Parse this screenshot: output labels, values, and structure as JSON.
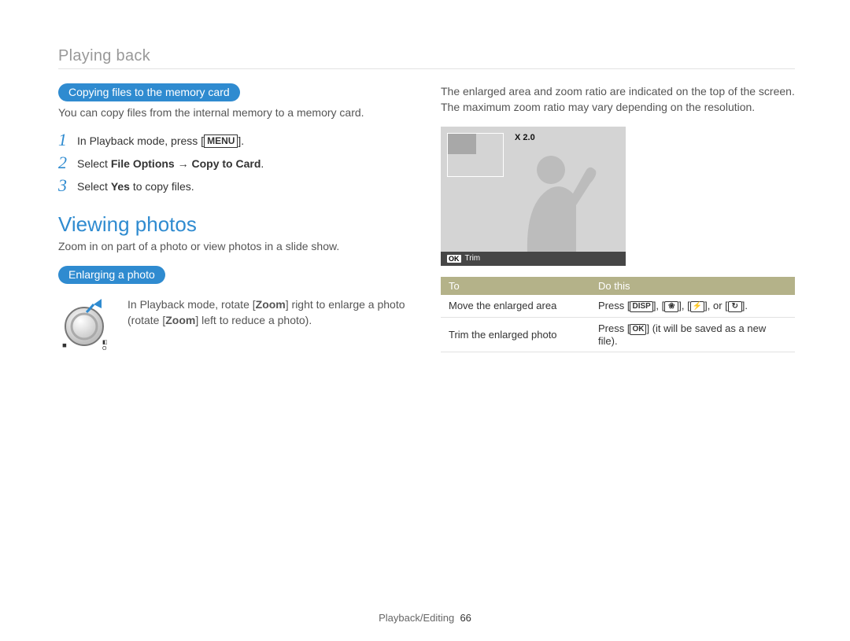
{
  "section_title": "Playing back",
  "left": {
    "pill1": "Copying files to the memory card",
    "intro1": "You can copy files from the internal memory to a memory card.",
    "steps": [
      {
        "num": "1",
        "pre": "In Playback mode, press [",
        "btn": "MENU",
        "post": "]."
      },
      {
        "num": "2",
        "pre": "Select ",
        "bold": "File Options → Copy to Card",
        "post": "."
      },
      {
        "num": "3",
        "pre": "Select ",
        "bold": "Yes",
        "post": " to copy files."
      }
    ],
    "h2": "Viewing photos",
    "subintro": "Zoom in on part of a photo or view photos in a slide show.",
    "pill2": "Enlarging a photo",
    "zoom_text_pre": "In Playback mode, rotate [",
    "zoom_bold1": "Zoom",
    "zoom_text_mid": "] right to enlarge a photo (rotate [",
    "zoom_bold2": "Zoom",
    "zoom_text_post": "] left to reduce a photo)."
  },
  "right": {
    "intro": "The enlarged area and zoom ratio are indicated on the top of the screen. The maximum zoom ratio may vary depending on the resolution.",
    "screen": {
      "zoom_label": "X 2.0",
      "ok": "OK",
      "trim": "Trim"
    },
    "table": {
      "headers": [
        "To",
        "Do this"
      ],
      "rows": [
        {
          "to": "Move the enlarged area",
          "do_pre": "Press [",
          "btns": [
            "DISP",
            "❀",
            "⚡",
            "↻"
          ],
          "do_sep": "], [",
          "do_or": "], or [",
          "do_post": "]."
        },
        {
          "to": "Trim the enlarged photo",
          "do_pre": "Press [",
          "btns": [
            "OK"
          ],
          "do_post": "] (it will be saved as a new file)."
        }
      ]
    }
  },
  "footer": {
    "section": "Playback/Editing",
    "page": "66"
  }
}
